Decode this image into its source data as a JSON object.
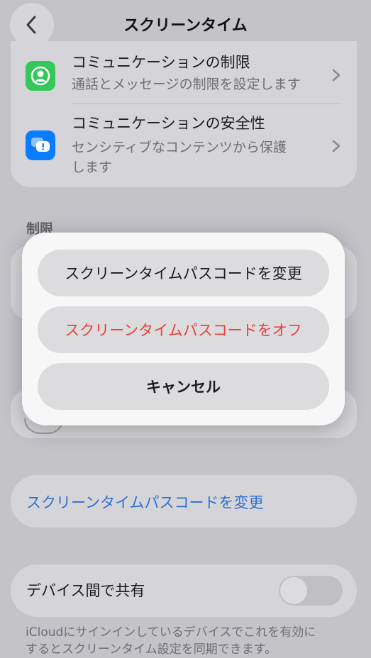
{
  "header": {
    "title": "スクリーンタイム",
    "back_icon": "chevron-left-icon"
  },
  "communication": {
    "limits": {
      "title": "コミュニケーションの制限",
      "subtitle": "通話とメッセージの制限を設定します",
      "icon": "person-circle-icon",
      "icon_color": "#34c759"
    },
    "safety": {
      "title": "コミュニケーションの安全性",
      "subtitle_line1": "センシティブなコンテンツから保護",
      "subtitle_line2": "します",
      "icon": "speech-bubble-alert-icon",
      "icon_color": "#0a7cff"
    }
  },
  "restrictions": {
    "section_label": "制限"
  },
  "passcode_link": {
    "label": "スクリーンタイムパスコードを変更"
  },
  "share": {
    "label": "デバイス間で共有",
    "enabled": false,
    "footer_line1": "iCloudにサインインしているデバイスでこれを有効に",
    "footer_line2": "するとスクリーンタイム設定を同期できます。"
  },
  "action_sheet": {
    "change_label": "スクリーンタイムパスコードを変更",
    "turn_off_label": "スクリーンタイムパスコードをオフ",
    "cancel_label": "キャンセル",
    "destructive_color": "#e8413c"
  }
}
